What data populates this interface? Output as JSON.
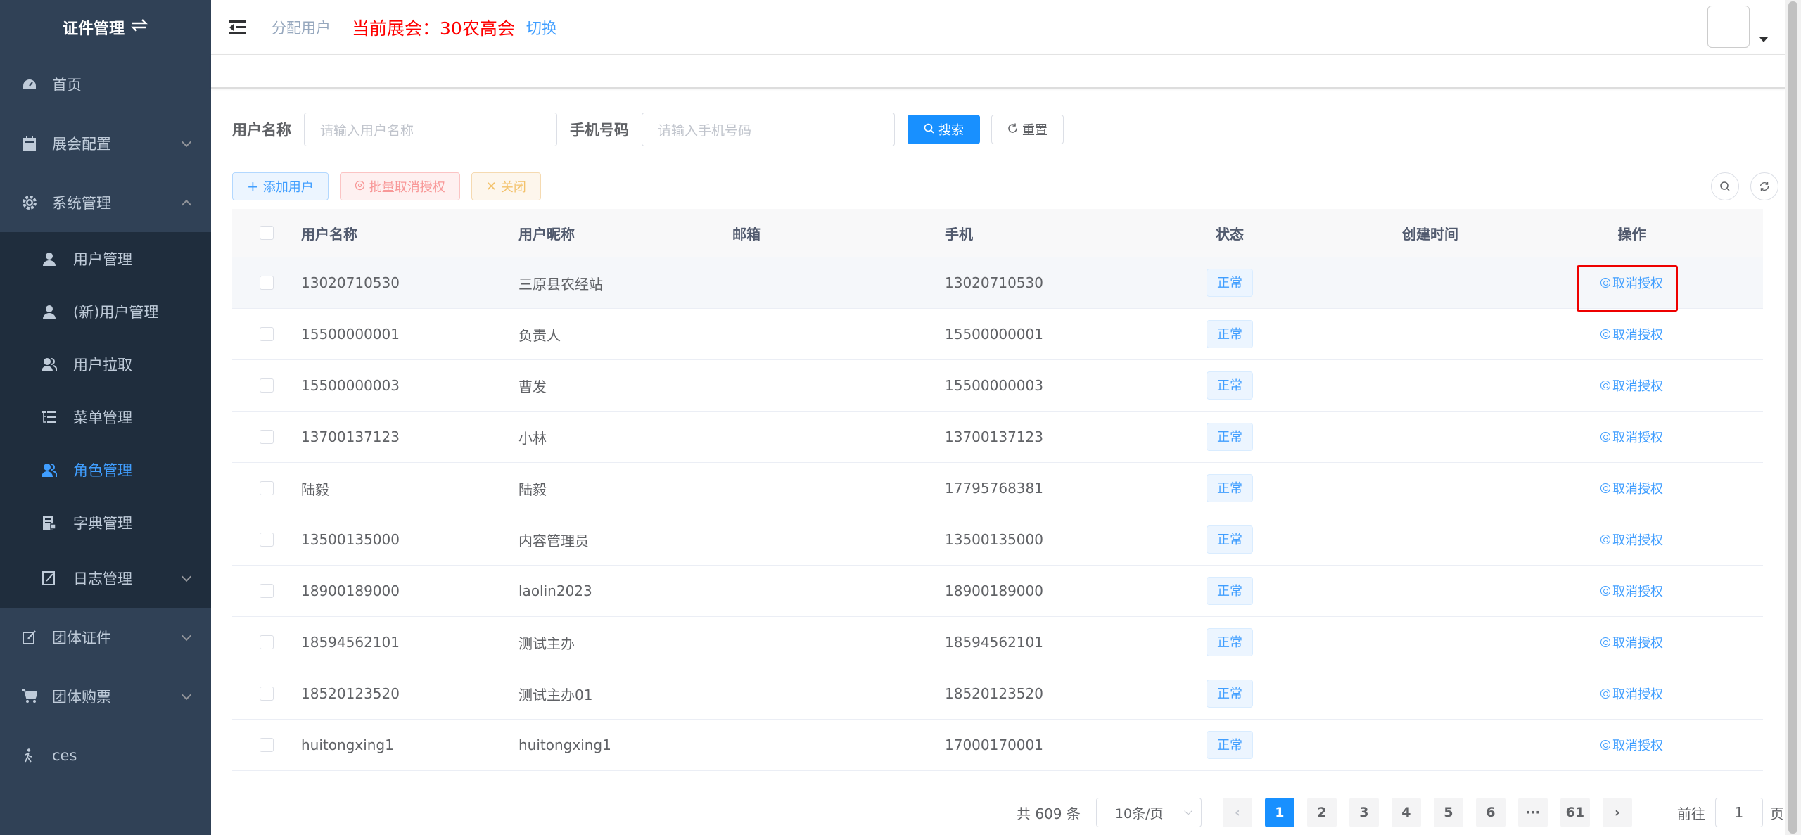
{
  "sidebar": {
    "title": "证件管理",
    "title_icon": "swap-icon",
    "items": [
      {
        "label": "首页",
        "icon": "dashboard-icon"
      },
      {
        "label": "展会配置",
        "icon": "calendar-icon"
      },
      {
        "label": "系统管理",
        "icon": "gear-icon"
      }
    ],
    "sub_items": [
      {
        "label": "用户管理",
        "icon": "user-icon"
      },
      {
        "label": "(新)用户管理",
        "icon": "user-icon"
      },
      {
        "label": "用户拉取",
        "icon": "users-icon"
      },
      {
        "label": "菜单管理",
        "icon": "tree-table-icon"
      },
      {
        "label": "角色管理",
        "icon": "peoples-icon"
      },
      {
        "label": "字典管理",
        "icon": "dict-icon"
      },
      {
        "label": "日志管理",
        "icon": "log-icon"
      }
    ],
    "bottom_items": [
      {
        "label": "团体证件",
        "icon": "edit-icon"
      },
      {
        "label": "团体购票",
        "icon": "cart-icon"
      },
      {
        "label": "ces",
        "icon": "person-walk-icon"
      }
    ],
    "active_color": "#409eff",
    "bg_color": "#304156"
  },
  "header": {
    "breadcrumb": "分配用户",
    "expo_label": "当前展会：",
    "expo_name": "30农高会",
    "switch_label": "切换"
  },
  "search": {
    "username_label": "用户名称",
    "username_placeholder": "请输入用户名称",
    "phone_label": "手机号码",
    "phone_placeholder": "请输入手机号码",
    "search_btn": "搜索",
    "reset_btn": "重置"
  },
  "toolbar": {
    "add_user": "添加用户",
    "batch_revoke": "批量取消授权",
    "close": "关闭"
  },
  "table": {
    "headers": [
      "用户名称",
      "用户昵称",
      "邮箱",
      "手机",
      "状态",
      "创建时间",
      "操作"
    ],
    "rows": [
      {
        "name": "13020710530",
        "nick": "三原县农经站",
        "email": "",
        "phone": "13020710530",
        "status": "正常",
        "time": "",
        "op": "取消授权"
      },
      {
        "name": "15500000001",
        "nick": "负责人",
        "email": "",
        "phone": "15500000001",
        "status": "正常",
        "time": "",
        "op": "取消授权"
      },
      {
        "name": "15500000003",
        "nick": "曹发",
        "email": "",
        "phone": "15500000003",
        "status": "正常",
        "time": "",
        "op": "取消授权"
      },
      {
        "name": "13700137123",
        "nick": "小林",
        "email": "",
        "phone": "13700137123",
        "status": "正常",
        "time": "",
        "op": "取消授权"
      },
      {
        "name": "陆毅",
        "nick": "陆毅",
        "email": "",
        "phone": "17795768381",
        "status": "正常",
        "time": "",
        "op": "取消授权"
      },
      {
        "name": "13500135000",
        "nick": "内容管理员",
        "email": "",
        "phone": "13500135000",
        "status": "正常",
        "time": "",
        "op": "取消授权"
      },
      {
        "name": "18900189000",
        "nick": "laolin2023",
        "email": "",
        "phone": "18900189000",
        "status": "正常",
        "time": "",
        "op": "取消授权"
      },
      {
        "name": "18594562101",
        "nick": "测试主办",
        "email": "",
        "phone": "18594562101",
        "status": "正常",
        "time": "",
        "op": "取消授权"
      },
      {
        "name": "18520123520",
        "nick": "测试主办01",
        "email": "",
        "phone": "18520123520",
        "status": "正常",
        "time": "",
        "op": "取消授权"
      },
      {
        "name": "huitongxing1",
        "nick": "huitongxing1",
        "email": "",
        "phone": "17000170001",
        "status": "正常",
        "time": "",
        "op": "取消授权"
      }
    ]
  },
  "pagination": {
    "total": "共 609 条",
    "page_size": "10条/页",
    "pages": [
      "1",
      "2",
      "3",
      "4",
      "5",
      "6",
      "···",
      "61"
    ],
    "current": "1",
    "goto_label": "前往",
    "goto_value": "1",
    "goto_suffix": "页"
  }
}
